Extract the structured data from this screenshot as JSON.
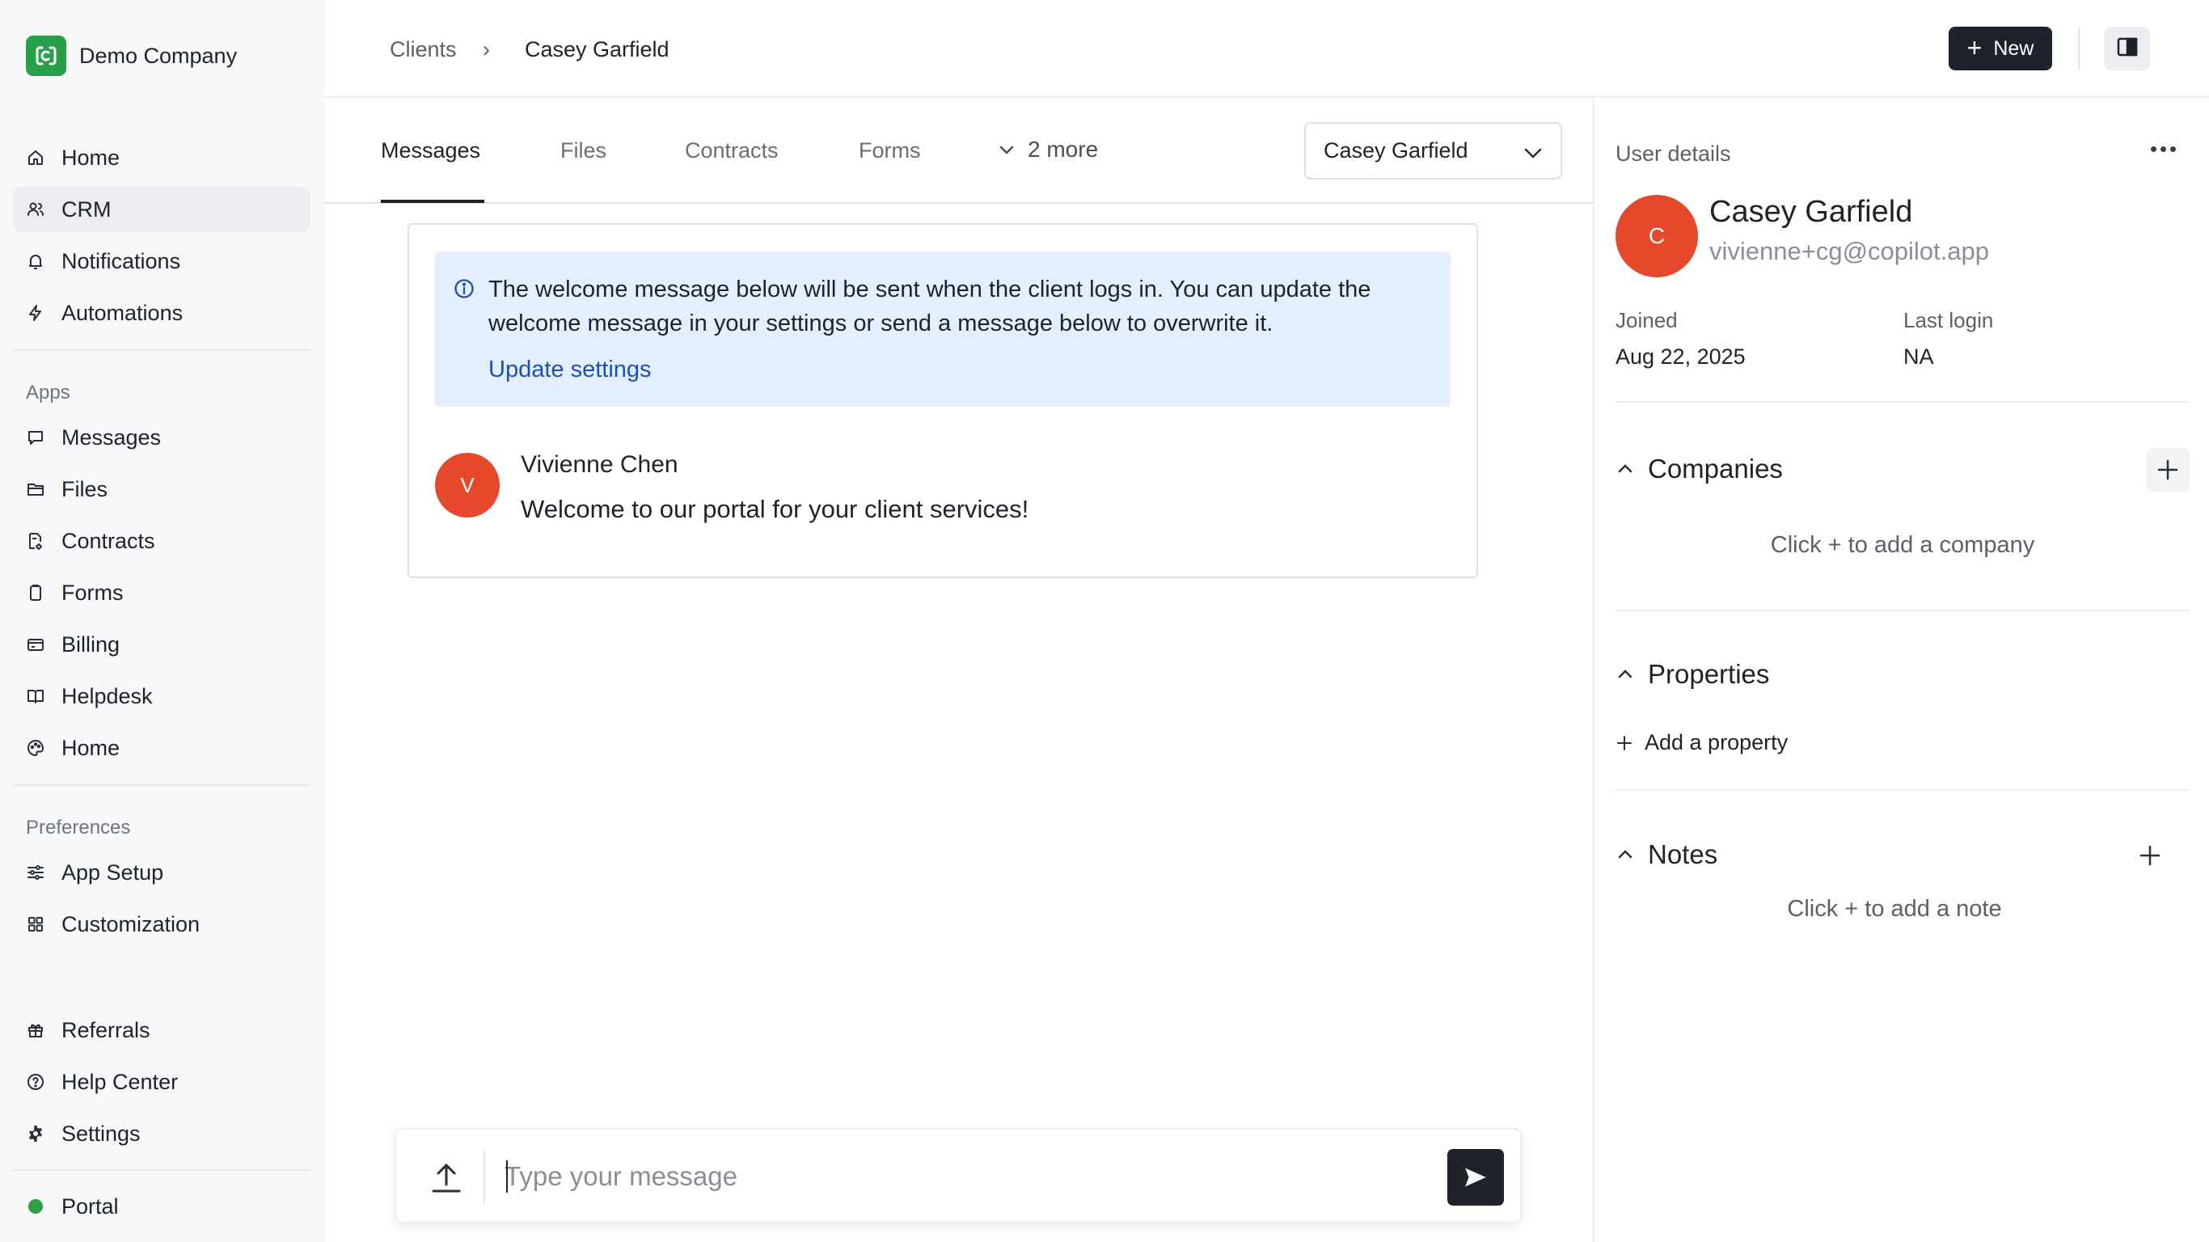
{
  "brand": {
    "name": "Demo Company",
    "logo_color": "#28a04b"
  },
  "nav": {
    "main": [
      {
        "label": "Home",
        "icon": "home-icon"
      },
      {
        "label": "CRM",
        "icon": "users-icon",
        "active": true
      },
      {
        "label": "Notifications",
        "icon": "bell-icon"
      },
      {
        "label": "Automations",
        "icon": "bolt-icon"
      }
    ],
    "apps_heading": "Apps",
    "apps": [
      {
        "label": "Messages",
        "icon": "message-icon"
      },
      {
        "label": "Files",
        "icon": "folder-icon"
      },
      {
        "label": "Contracts",
        "icon": "contract-icon"
      },
      {
        "label": "Forms",
        "icon": "clipboard-icon"
      },
      {
        "label": "Billing",
        "icon": "credit-card-icon"
      },
      {
        "label": "Helpdesk",
        "icon": "book-icon"
      },
      {
        "label": "Home",
        "icon": "palette-icon"
      }
    ],
    "preferences_heading": "Preferences",
    "preferences": [
      {
        "label": "App Setup",
        "icon": "sliders-icon"
      },
      {
        "label": "Customization",
        "icon": "grid-icon"
      }
    ],
    "bottom": [
      {
        "label": "Referrals",
        "icon": "gift-icon"
      },
      {
        "label": "Help Center",
        "icon": "help-icon"
      },
      {
        "label": "Settings",
        "icon": "gear-icon"
      }
    ],
    "portal": {
      "label": "Portal",
      "status_color": "#2f9e44"
    }
  },
  "breadcrumb": {
    "root": "Clients",
    "separator": "›",
    "current": "Casey Garfield"
  },
  "toolbar": {
    "new_label": "New"
  },
  "tabs": {
    "items": [
      "Messages",
      "Files",
      "Contracts",
      "Forms"
    ],
    "active": "Messages",
    "more_label": "2 more"
  },
  "client_select": {
    "value": "Casey Garfield"
  },
  "banner": {
    "text": "The welcome message below will be sent when the client logs in. You can update the welcome message in your settings or send a message below to overwrite it.",
    "link": "Update settings"
  },
  "message": {
    "avatar_initial": "V",
    "author": "Vivienne Chen",
    "body": "Welcome to our portal for your client services!"
  },
  "composer": {
    "placeholder": "Type your message"
  },
  "details": {
    "title": "User details",
    "avatar_initial": "C",
    "name": "Casey Garfield",
    "email": "vivienne+cg@copilot.app",
    "joined_label": "Joined",
    "joined_value": "Aug 22, 2025",
    "last_login_label": "Last login",
    "last_login_value": "NA",
    "companies": {
      "heading": "Companies",
      "empty": "Click + to add a company"
    },
    "properties": {
      "heading": "Properties",
      "add_label": "Add a property"
    },
    "notes": {
      "heading": "Notes",
      "empty": "Click + to add a note"
    }
  },
  "colors": {
    "accent_dark": "#1e222a",
    "avatar": "#e5482a",
    "banner_bg": "#e3efff",
    "link": "#1f4fb3"
  }
}
